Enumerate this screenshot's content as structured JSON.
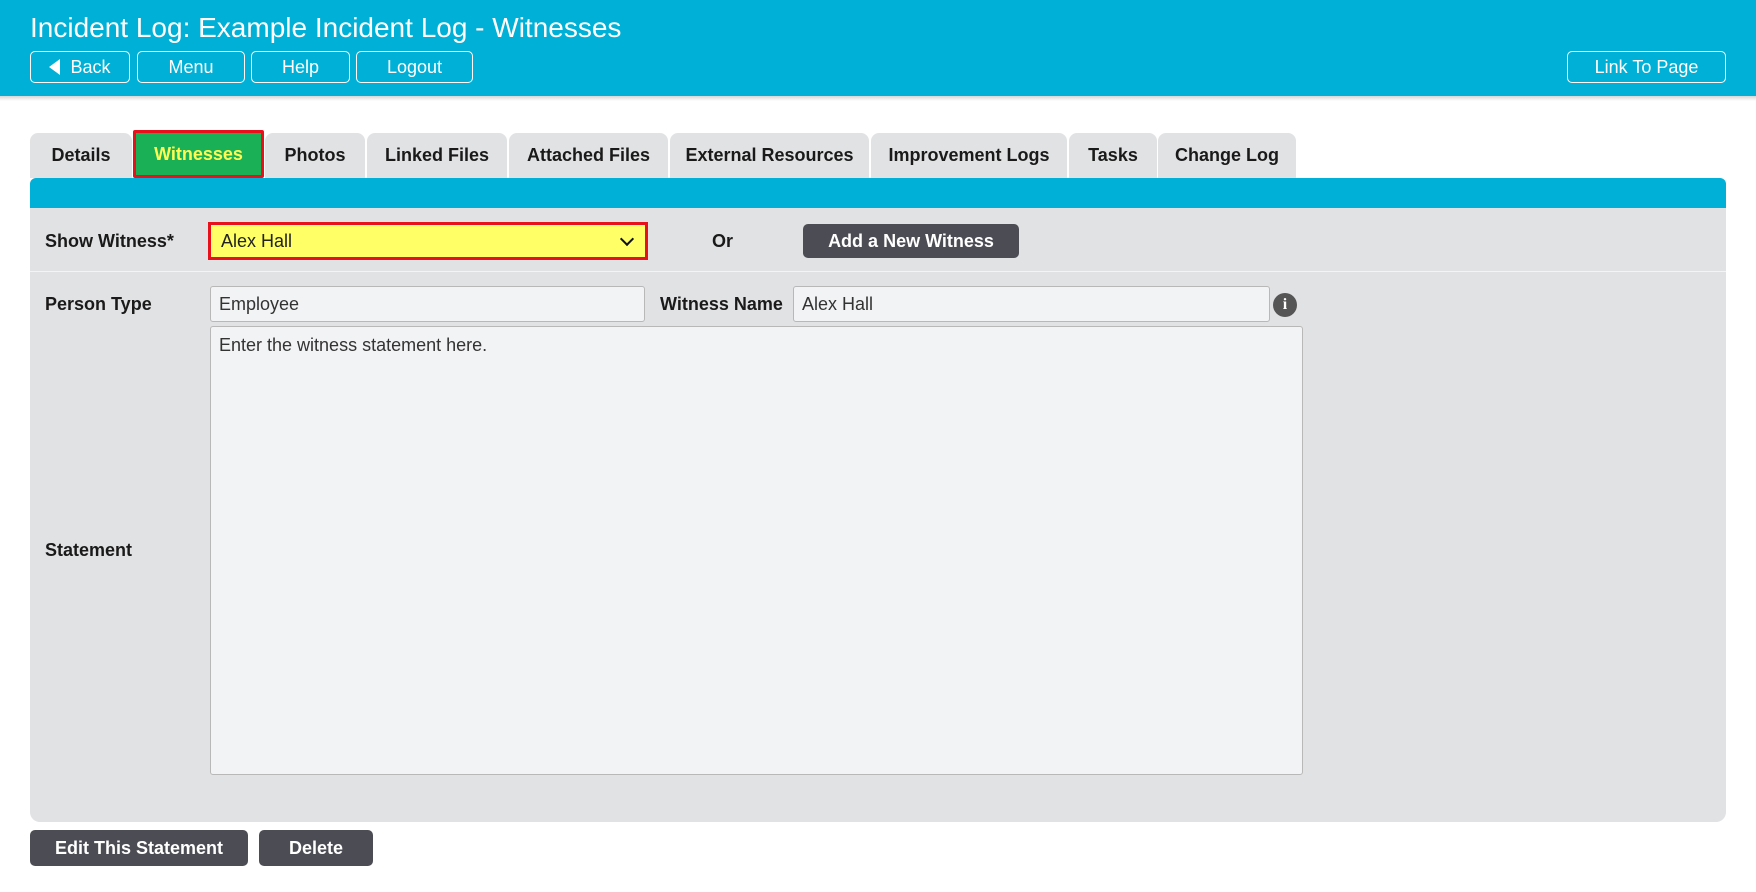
{
  "header": {
    "title": "Incident Log: Example Incident Log - Witnesses",
    "buttons": {
      "back": "Back",
      "menu": "Menu",
      "help": "Help",
      "logout": "Logout",
      "link_to_page": "Link To Page"
    }
  },
  "tabs": [
    {
      "label": "Details"
    },
    {
      "label": "Witnesses",
      "active": true
    },
    {
      "label": "Photos"
    },
    {
      "label": "Linked Files"
    },
    {
      "label": "Attached Files"
    },
    {
      "label": "External Resources"
    },
    {
      "label": "Improvement Logs"
    },
    {
      "label": "Tasks"
    },
    {
      "label": "Change Log"
    }
  ],
  "witness_selector": {
    "label": "Show Witness*",
    "selected": "Alex Hall",
    "or_text": "Or",
    "add_button": "Add a New Witness"
  },
  "form": {
    "person_type_label": "Person Type",
    "person_type_value": "Employee",
    "witness_name_label": "Witness Name",
    "witness_name_value": "Alex Hall",
    "statement_label": "Statement",
    "statement_value": "Enter the witness statement here."
  },
  "actions": {
    "edit": "Edit This Statement",
    "delete": "Delete"
  },
  "colors": {
    "header_bg": "#00b0d6",
    "active_tab_bg": "#1ab055",
    "active_tab_text": "#ffff55",
    "highlight_border": "#e8101a",
    "select_bg": "#ffff66",
    "dark_button": "#4c4c54",
    "panel_bg": "#e1e2e4"
  }
}
